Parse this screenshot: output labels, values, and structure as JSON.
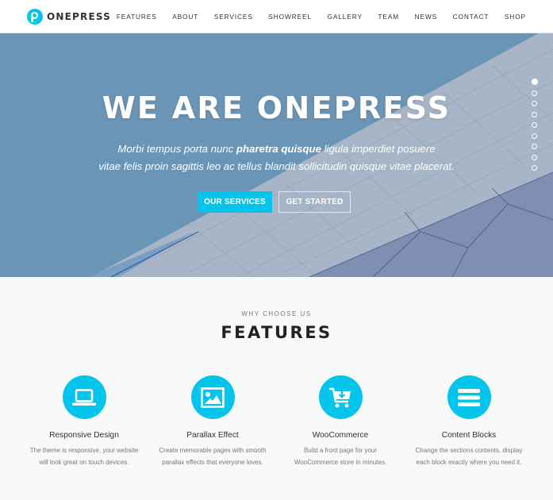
{
  "header": {
    "logo_text": "ONEPRESS",
    "nav": [
      "FEATURES",
      "ABOUT",
      "SERVICES",
      "SHOWREEL",
      "GALLERY",
      "TEAM",
      "NEWS",
      "CONTACT",
      "SHOP"
    ]
  },
  "hero": {
    "title": "WE ARE ONEPRESS",
    "subtitle_pre": "Morbi tempus porta nunc ",
    "subtitle_bold": "pharetra quisque",
    "subtitle_post": " ligula imperdiet posuere",
    "subtitle_line2": "vitae felis proin sagittis leo ac tellus blandit sollicitudin quisque vitae placerat.",
    "primary_button": "OUR SERVICES",
    "secondary_button": "GET STARTED",
    "section_dots": 9,
    "active_dot": 1
  },
  "features": {
    "eyebrow": "WHY CHOOSE US",
    "title": "FEATURES",
    "items": [
      {
        "icon": "laptop-icon",
        "title": "Responsive Design",
        "desc_line1": "The theme is responsive, your website",
        "desc_line2": "will look great on touch devices."
      },
      {
        "icon": "image-icon",
        "title": "Parallax Effect",
        "desc_line1": "Create memorable pages with smooth",
        "desc_line2": "parallax effects that everyone loves."
      },
      {
        "icon": "cart-download-icon",
        "title": "WooCommerce",
        "desc_line1": "Build a front page for your",
        "desc_line2": "WooCommerce store in minutes."
      },
      {
        "icon": "menu-bars-icon",
        "title": "Content Blocks",
        "desc_line1": "Change the sections contents, display",
        "desc_line2": "each block exactly where you need it."
      }
    ]
  },
  "colors": {
    "accent": "#03c4eb",
    "hero_bg": "#6b95b6",
    "section_bg": "#f8f9f9"
  }
}
